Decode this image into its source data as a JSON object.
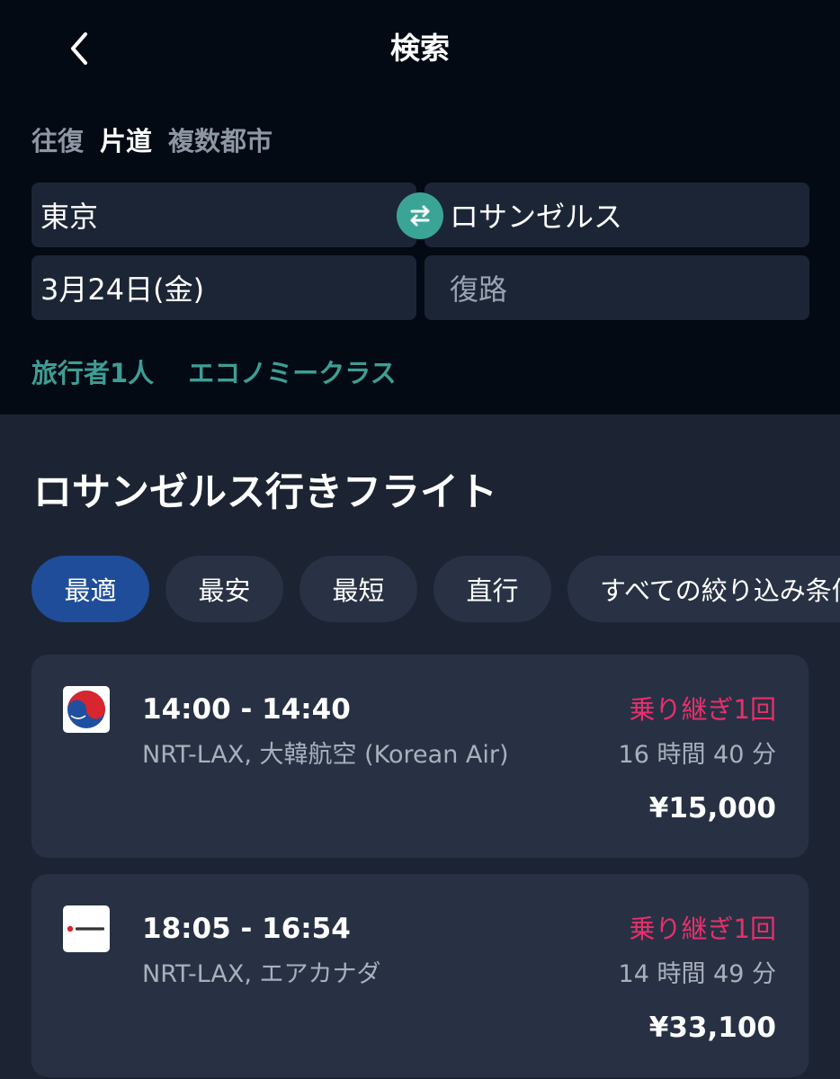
{
  "header": {
    "title": "検索"
  },
  "trip_types": [
    {
      "label": "往復",
      "active": false
    },
    {
      "label": "片道",
      "active": true
    },
    {
      "label": "複数都市",
      "active": false
    }
  ],
  "search": {
    "origin": "東京",
    "destination": "ロサンゼルス",
    "depart_date": "3月24日(金)",
    "return_placeholder": "復路"
  },
  "options": {
    "travelers": "旅行者1人",
    "cabin_class": "エコノミークラス"
  },
  "results": {
    "title": "ロサンゼルス行きフライト",
    "chips": [
      "最適",
      "最安",
      "最短",
      "直行",
      "すべての絞り込み条件"
    ],
    "active_chip": "最適",
    "flights": [
      {
        "times": "14:00 - 14:40",
        "route": "NRT-LAX, 大韓航空 (Korean Air)",
        "stops": "乗り継ぎ1回",
        "duration": "16 時間 40 分",
        "price": "¥15,000",
        "logo_icon": "korean-air-logo"
      },
      {
        "times": "18:05 - 16:54",
        "route": "NRT-LAX, エアカナダ",
        "stops": "乗り継ぎ1回",
        "duration": "14 時間 49 分",
        "price": "¥33,100",
        "logo_icon": "air-canada-logo"
      }
    ]
  },
  "colors": {
    "accent_teal": "#3aa597",
    "stops_pink": "#e6306c",
    "chip_active": "#1f4d9a"
  }
}
